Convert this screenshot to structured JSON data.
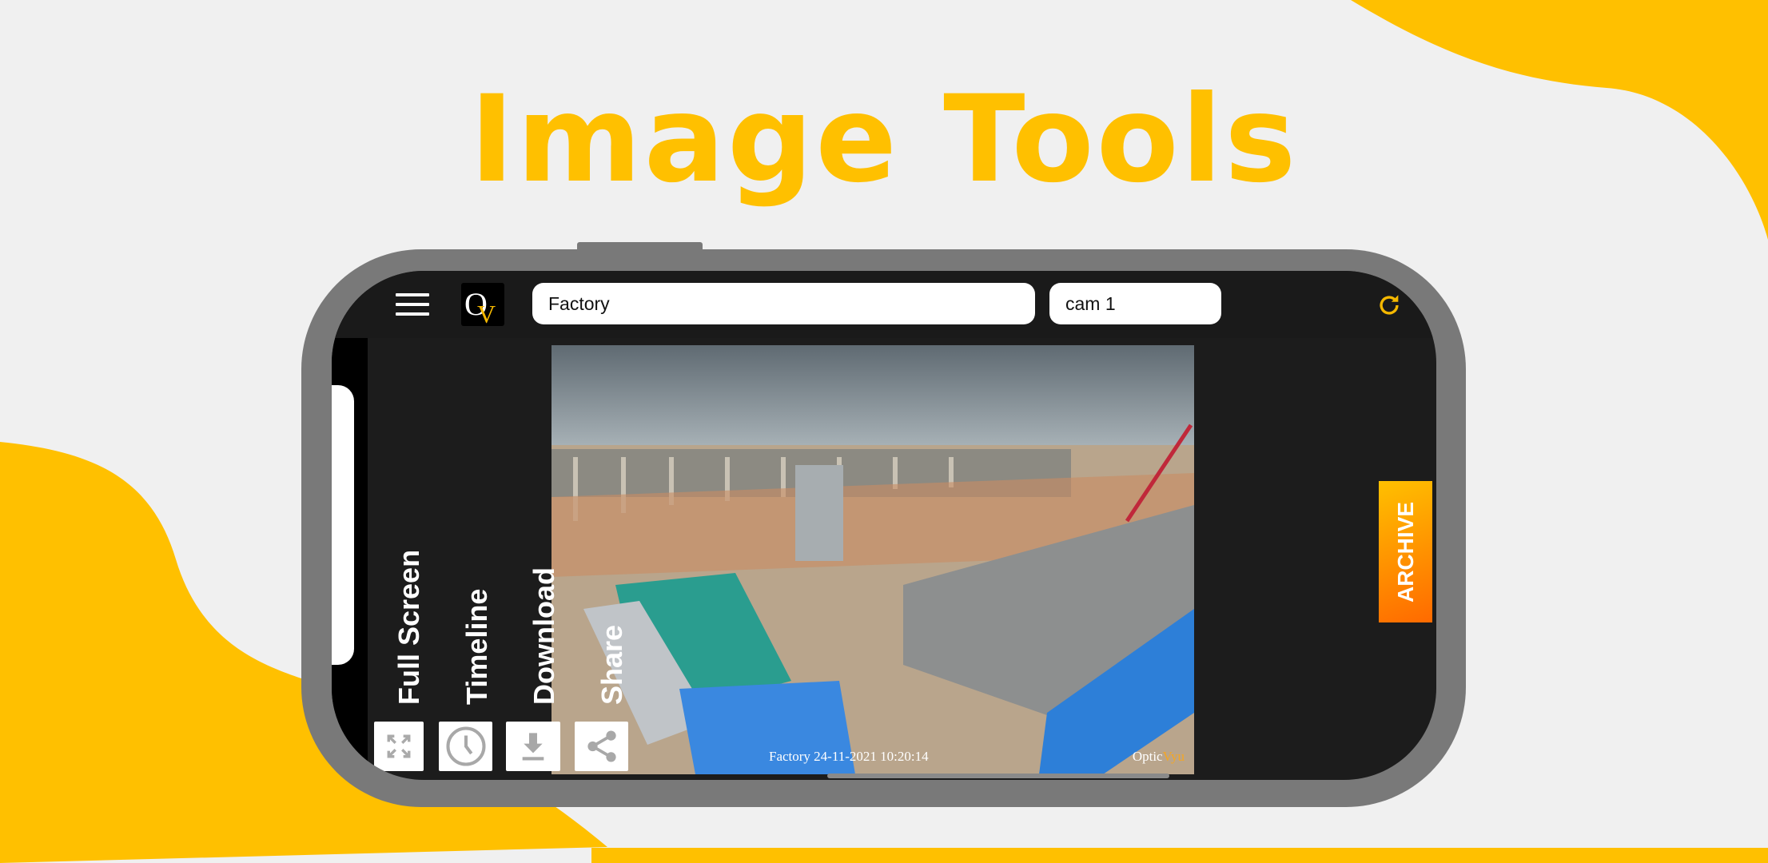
{
  "title": "Image Tools",
  "colors": {
    "accent": "#ffc000",
    "archive": "#ff8a00",
    "phone_frame": "#797979",
    "screen_bg": "#1c1c1c"
  },
  "header": {
    "menu_icon": "hamburger-icon",
    "logo_text": "OV",
    "site_field": "Factory",
    "camera_field": "cam 1",
    "refresh_icon": "refresh-icon"
  },
  "tools": [
    {
      "label": "Full Screen",
      "icon": "fullscreen-icon"
    },
    {
      "label": "Timeline",
      "icon": "clock-icon"
    },
    {
      "label": "Download",
      "icon": "download-icon"
    },
    {
      "label": "Share",
      "icon": "share-icon"
    }
  ],
  "image": {
    "caption": "Factory 24-11-2021 10:20:14",
    "watermark_a": "Optic",
    "watermark_b": "Vyu"
  },
  "archive_label": "ARCHIVE"
}
